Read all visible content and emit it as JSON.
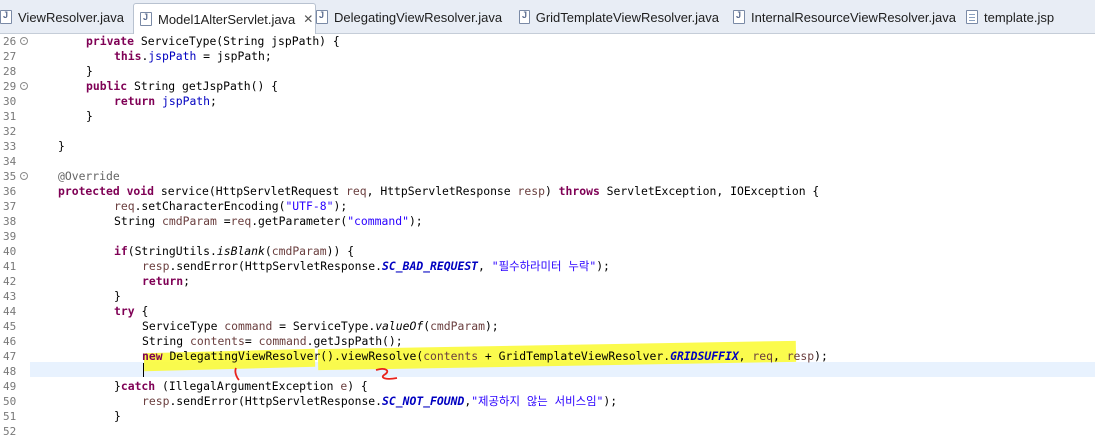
{
  "tabs": [
    {
      "label": "ViewResolver.java",
      "icon": "java-file-icon",
      "active": false
    },
    {
      "label": "Model1AlterServlet.java",
      "icon": "java-file-icon",
      "active": true,
      "close": "✕"
    },
    {
      "label": "DelegatingViewResolver.java",
      "icon": "java-file-icon",
      "active": false
    },
    {
      "label": "GridTemplateViewResolver.java",
      "icon": "java-file-icon",
      "active": false
    },
    {
      "label": "InternalResourceViewResolver.java",
      "icon": "java-file-icon",
      "active": false
    },
    {
      "label": "template.jsp",
      "icon": "jsp-file-icon",
      "active": false
    }
  ],
  "editor": {
    "current_line": "48",
    "lines": [
      {
        "n": "26",
        "fold": true
      },
      {
        "n": "27"
      },
      {
        "n": "28"
      },
      {
        "n": "29",
        "fold": true
      },
      {
        "n": "30"
      },
      {
        "n": "31"
      },
      {
        "n": "32"
      },
      {
        "n": "33"
      },
      {
        "n": "34"
      },
      {
        "n": "35",
        "fold": true
      },
      {
        "n": "36"
      },
      {
        "n": "37"
      },
      {
        "n": "38"
      },
      {
        "n": "39"
      },
      {
        "n": "40"
      },
      {
        "n": "41"
      },
      {
        "n": "42"
      },
      {
        "n": "43"
      },
      {
        "n": "44"
      },
      {
        "n": "45"
      },
      {
        "n": "46"
      },
      {
        "n": "47"
      },
      {
        "n": "48"
      },
      {
        "n": "49"
      },
      {
        "n": "50"
      },
      {
        "n": "51"
      },
      {
        "n": "52"
      }
    ],
    "code": [
      [
        [
          "kw",
          "private "
        ],
        [
          "",
          "ServiceType(String jspPath) {"
        ]
      ],
      [
        [
          "kw",
          "this"
        ],
        [
          "",
          "."
        ],
        [
          "fld",
          "jspPath"
        ],
        [
          "",
          " = jspPath;"
        ]
      ],
      [
        [
          "",
          "}"
        ]
      ],
      [
        [
          "kw",
          "public "
        ],
        [
          "",
          "String getJspPath() {"
        ]
      ],
      [
        [
          "kw",
          "return "
        ],
        [
          "fld",
          "jspPath"
        ],
        [
          "",
          ";"
        ]
      ],
      [
        [
          "",
          "}"
        ]
      ],
      [
        [
          "",
          ""
        ]
      ],
      [
        [
          "",
          "}"
        ]
      ],
      [
        [
          "",
          ""
        ]
      ],
      [
        [
          "ann",
          "@Override"
        ]
      ],
      [
        [
          "kw",
          "protected void "
        ],
        [
          "",
          "service(HttpServletRequest "
        ],
        [
          "var",
          "req"
        ],
        [
          "",
          ", HttpServletResponse "
        ],
        [
          "var",
          "resp"
        ],
        [
          "",
          ") "
        ],
        [
          "kw",
          "throws "
        ],
        [
          "",
          "ServletException, IOException {"
        ]
      ],
      [
        [
          "var",
          "req"
        ],
        [
          "",
          ".setCharacterEncoding("
        ],
        [
          "str",
          "\"UTF-8\""
        ],
        [
          "",
          ");"
        ]
      ],
      [
        [
          "",
          "String "
        ],
        [
          "var",
          "cmdParam"
        ],
        [
          "",
          " ="
        ],
        [
          "var",
          "req"
        ],
        [
          "",
          ".getParameter("
        ],
        [
          "str",
          "\"command\""
        ],
        [
          "",
          ");"
        ]
      ],
      [
        [
          "",
          ""
        ]
      ],
      [
        [
          "kw",
          "if"
        ],
        [
          "",
          "(StringUtils."
        ],
        [
          "it",
          "isBlank"
        ],
        [
          "",
          "("
        ],
        [
          "var",
          "cmdParam"
        ],
        [
          "",
          ")) {"
        ]
      ],
      [
        [
          "var",
          "resp"
        ],
        [
          "",
          ".sendError(HttpServletResponse."
        ],
        [
          "itf",
          "SC_BAD_REQUEST"
        ],
        [
          "",
          ", "
        ],
        [
          "str",
          "\"필수하라미터 누락\""
        ],
        [
          "",
          ");"
        ]
      ],
      [
        [
          "kw",
          "return"
        ],
        [
          "",
          ";"
        ]
      ],
      [
        [
          "",
          "}"
        ]
      ],
      [
        [
          "kw",
          "try "
        ],
        [
          "",
          "{"
        ]
      ],
      [
        [
          "",
          "ServiceType "
        ],
        [
          "var",
          "command"
        ],
        [
          "",
          " = ServiceType."
        ],
        [
          "it",
          "valueOf"
        ],
        [
          "",
          "("
        ],
        [
          "var",
          "cmdParam"
        ],
        [
          "",
          ");"
        ]
      ],
      [
        [
          "",
          "String "
        ],
        [
          "var",
          "contents"
        ],
        [
          "",
          "= "
        ],
        [
          "var",
          "command"
        ],
        [
          "",
          ".getJspPath();"
        ]
      ],
      [
        [
          "kw",
          "new "
        ],
        [
          "",
          "DelegatingViewResolver()."
        ],
        [
          "",
          "viewResolve("
        ],
        [
          "var",
          "contents"
        ],
        [
          "",
          " + GridTemplateViewResolver."
        ],
        [
          "itf",
          "GRIDSUFFIX"
        ],
        [
          "",
          ", "
        ],
        [
          "var",
          "req"
        ],
        [
          "",
          ", "
        ],
        [
          "var",
          "resp"
        ],
        [
          "",
          ");"
        ]
      ],
      [
        [
          "",
          ""
        ]
      ],
      [
        [
          "",
          "}"
        ],
        [
          "kw",
          "catch "
        ],
        [
          "",
          "(IllegalArgumentException "
        ],
        [
          "var",
          "e"
        ],
        [
          "",
          ") {"
        ]
      ],
      [
        [
          "var",
          "resp"
        ],
        [
          "",
          ".sendError(HttpServletResponse."
        ],
        [
          "itf",
          "SC_NOT_FOUND"
        ],
        [
          "",
          ","
        ],
        [
          "str",
          "\"제공하지 않는 서비스임\""
        ],
        [
          "",
          ");"
        ]
      ],
      [
        [
          "",
          "}"
        ]
      ],
      [
        [
          "",
          ""
        ]
      ]
    ]
  },
  "annotations": {
    "color": "#e8231d",
    "highlight_color": "#fbfb3a",
    "mark1": "1",
    "mark2": "2"
  }
}
